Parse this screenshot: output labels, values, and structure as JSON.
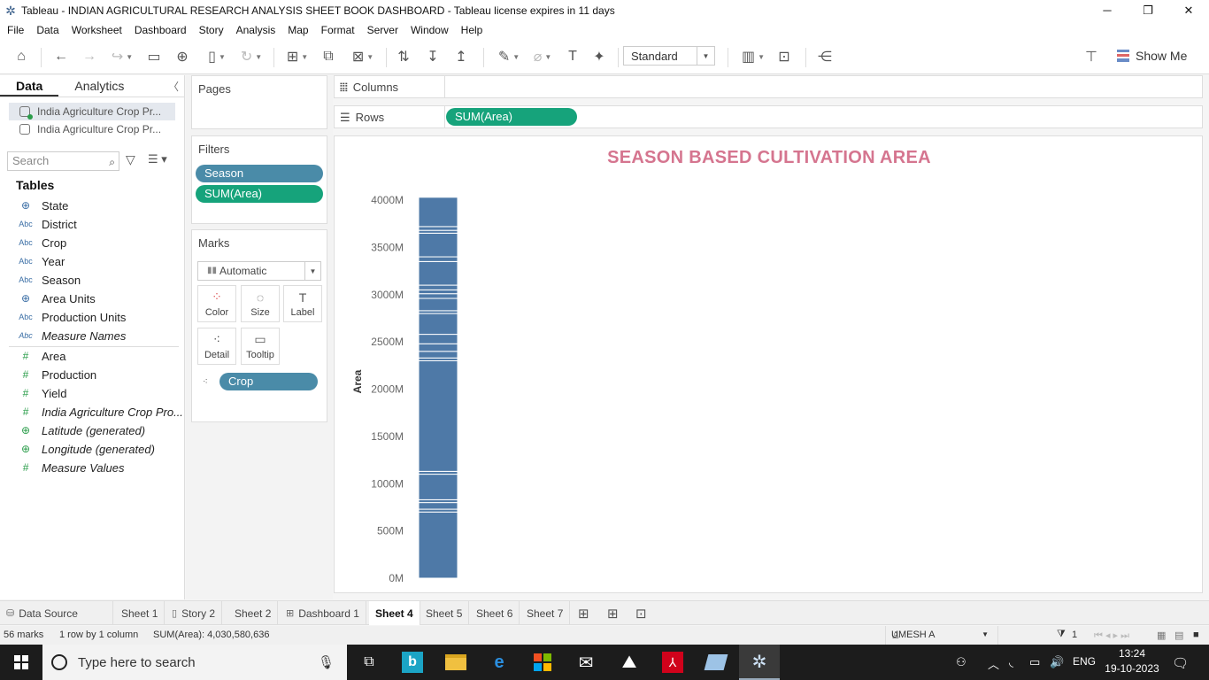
{
  "window": {
    "title": "Tableau - INDIAN AGRICULTURAL RESEARCH ANALYSIS SHEET BOOK DASHBOARD - Tableau license expires in 11 days",
    "minimize": "─",
    "maximize": "❐",
    "close": "✕"
  },
  "menu": [
    "File",
    "Data",
    "Worksheet",
    "Dashboard",
    "Story",
    "Analysis",
    "Map",
    "Format",
    "Server",
    "Window",
    "Help"
  ],
  "toolbar": {
    "mark_size_select": "Standard",
    "show_me_label": "Show Me"
  },
  "data_pane": {
    "tabs": [
      "Data",
      "Analytics"
    ],
    "data_sources": [
      "India Agriculture Crop Pr...",
      "India Agriculture Crop Pr..."
    ],
    "search_placeholder": "Search",
    "tables_heading": "Tables",
    "dimension_fields": [
      {
        "name": "State",
        "icon": "globe-icon"
      },
      {
        "name": "District",
        "icon": "abc-icon"
      },
      {
        "name": "Crop",
        "icon": "abc-icon"
      },
      {
        "name": "Year",
        "icon": "abc-icon"
      },
      {
        "name": "Season",
        "icon": "abc-icon"
      },
      {
        "name": "Area Units",
        "icon": "globe-icon"
      },
      {
        "name": "Production Units",
        "icon": "abc-icon"
      },
      {
        "name": "Measure Names",
        "icon": "abc-icon"
      }
    ],
    "measure_fields": [
      {
        "name": "Area",
        "icon": "hash-icon"
      },
      {
        "name": "Production",
        "icon": "hash-icon"
      },
      {
        "name": "Yield",
        "icon": "hash-icon"
      },
      {
        "name": "India Agriculture Crop Pro...",
        "icon": "hash-icon"
      },
      {
        "name": "Latitude (generated)",
        "icon": "globe-icon"
      },
      {
        "name": "Longitude (generated)",
        "icon": "globe-icon"
      },
      {
        "name": "Measure Values",
        "icon": "hash-icon"
      }
    ],
    "abc_glyph": "Abc"
  },
  "shelves": {
    "pages_title": "Pages",
    "filters_title": "Filters",
    "filters": [
      "Season",
      "SUM(Area)"
    ],
    "marks_title": "Marks",
    "mark_type": "Automatic",
    "mark_buttons": [
      "Color",
      "Size",
      "Label",
      "Detail",
      "Tooltip"
    ],
    "marks_pill": "Crop",
    "columns_label": "Columns",
    "rows_label": "Rows",
    "rows_pill": "SUM(Area)"
  },
  "viz": {
    "title": "SEASON BASED CULTIVATION AREA"
  },
  "chart_data": {
    "type": "bar",
    "stacked": true,
    "title": "SEASON BASED CULTIVATION AREA",
    "ylabel": "Area",
    "xlabel": "",
    "ylim": [
      0,
      4000000000
    ],
    "y_ticks": [
      "0M",
      "500M",
      "1000M",
      "1500M",
      "2000M",
      "2500M",
      "3000M",
      "3500M",
      "4000M"
    ],
    "y_tick_values": [
      0,
      500000000,
      1000000000,
      1500000000,
      2000000000,
      2500000000,
      3000000000,
      3500000000,
      4000000000
    ],
    "total": 4030580636,
    "segment_boundaries_M": [
      700,
      730,
      800,
      830,
      1100,
      1130,
      2300,
      2330,
      2400,
      2480,
      2580,
      2800,
      2830,
      2960,
      3010,
      3050,
      3100,
      3350,
      3400,
      3650,
      3680,
      3720,
      4030
    ],
    "color": "#4e79a7",
    "grid": false
  },
  "sheet_tabs": {
    "data_source": "Data Source",
    "tabs": [
      "Sheet 1",
      "Story 2",
      "Sheet 2",
      "Dashboard 1",
      "Sheet 4",
      "Sheet 5",
      "Sheet 6",
      "Sheet 7"
    ],
    "active": "Sheet 4"
  },
  "status": {
    "marks": "56 marks",
    "dims": "1 row by 1 column",
    "sum": "SUM(Area): 4,030,580,636",
    "user": "UMESH A",
    "filter_count": "1"
  },
  "taskbar": {
    "search_placeholder": "Type here to search",
    "lang": "ENG",
    "time": "13:24",
    "date": "19-10-2023"
  }
}
